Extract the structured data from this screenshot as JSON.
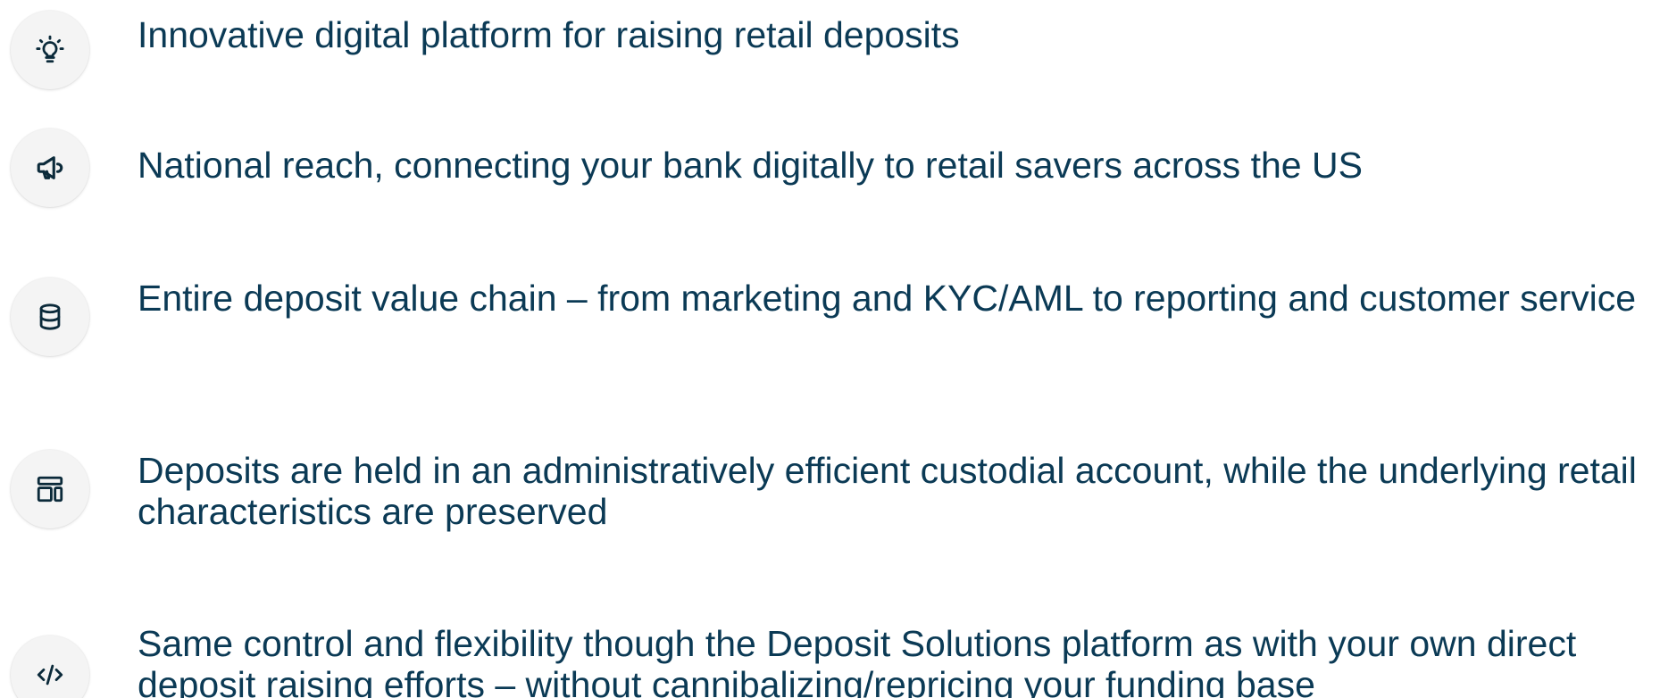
{
  "features": [
    {
      "icon": "lightbulb-icon",
      "text": "Innovative digital platform for raising retail deposits"
    },
    {
      "icon": "megaphone-icon",
      "text": "National reach, connecting your bank digitally to retail savers across the US"
    },
    {
      "icon": "database-icon",
      "text": "Entire deposit value chain – from marketing and KYC/AML to reporting and customer service"
    },
    {
      "icon": "layout-icon",
      "text": "Deposits are held in an administratively efficient custodial account, while the underlying retail characteristics are preserved"
    },
    {
      "icon": "code-icon",
      "text": "Same control and flexibility though the Deposit Solutions platform as with your own direct deposit raising efforts – without cannibalizing/repricing your funding base"
    }
  ],
  "colors": {
    "text": "#0b3a55",
    "icon_background": "#f4f4f4"
  }
}
